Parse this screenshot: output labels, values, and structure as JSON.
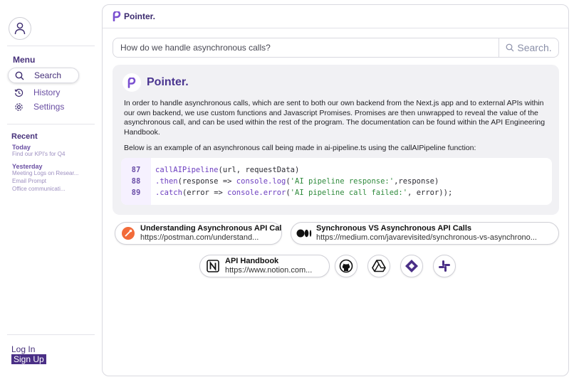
{
  "sidebar": {
    "menu_title": "Menu",
    "items": [
      {
        "label": "Search",
        "icon": "search-icon"
      },
      {
        "label": "History",
        "icon": "history-icon"
      },
      {
        "label": "Settings",
        "icon": "gear-icon"
      }
    ],
    "recent_title": "Recent",
    "recent_groups": [
      {
        "label": "Today",
        "items": [
          "Find our KPI's for Q4"
        ]
      },
      {
        "label": "Yesterday",
        "items": [
          "Meeting Logs on Resear...",
          "Email Prompt",
          "Office communicati..."
        ]
      }
    ],
    "login_label": "Log In",
    "signup_label": "Sign Up"
  },
  "header": {
    "brand": "Pointer."
  },
  "search": {
    "value": "How do we handle asynchronous calls?",
    "button_label": "Search."
  },
  "answer": {
    "brand": "Pointer.",
    "paragraph1": "In order to handle asynchronous calls, which are sent to both our own backend from the Next.js app and to external APIs within our own backend, we use custom functions and Javascript Promises. Promises are then unwrapped to reveal the value of the asynchronous call, and can be used within the rest of the program. The documentation can be found within the API Engineering Handbook.",
    "paragraph2": "Below is an example of an asynchronous call being made in ai-pipeline.ts using the callAIPipeline function:",
    "code_lines": [
      {
        "number": "87",
        "text": "callAIPipeline(url, requestData)"
      },
      {
        "number": "88",
        "text": ".then(response => console.log('AI pipeline response:',response)"
      },
      {
        "number": "89",
        "text": ".catch(error => console.error('AI pipeline call failed:', error));"
      }
    ]
  },
  "sources": [
    {
      "title": "Understanding Asynchronous API Calls",
      "url": "https://postman.com/understand...",
      "icon": "postman-icon"
    },
    {
      "title": "Synchronous VS Asynchronous API Calls",
      "url": "https://medium.com/javarevisited/synchronous-vs-asynchrono...",
      "icon": "medium-icon"
    },
    {
      "title": "API Handbook",
      "url": "https://www.notion.com...",
      "icon": "notion-icon"
    }
  ],
  "integrations": [
    "github-icon",
    "google-drive-icon",
    "jira-icon",
    "slack-icon"
  ],
  "colors": {
    "accent": "#4a2f86",
    "link": "#6a4fa3",
    "answer_bg": "#f1f1f4"
  }
}
